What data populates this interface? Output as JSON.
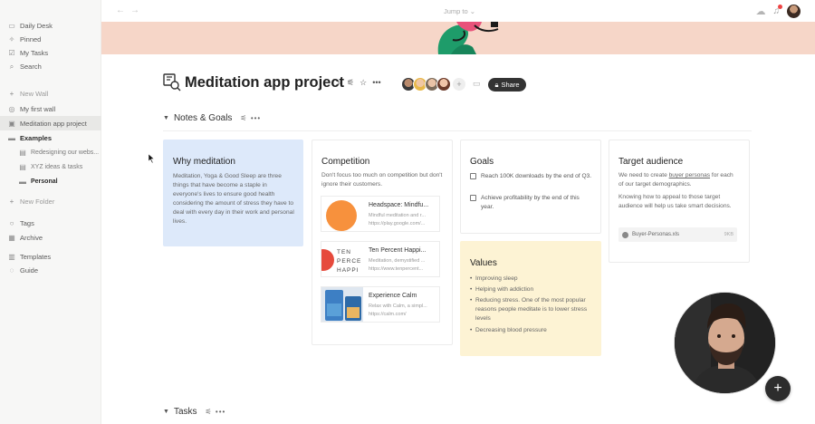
{
  "sidebar": {
    "items": [
      {
        "label": "Daily Desk",
        "icon": "desk-icon"
      },
      {
        "label": "Pinned",
        "icon": "pin-icon"
      },
      {
        "label": "My Tasks",
        "icon": "check-icon"
      },
      {
        "label": "Search",
        "icon": "search-icon"
      }
    ],
    "new_wall": "New Wall",
    "walls": [
      {
        "label": "My first wall"
      },
      {
        "label": "Meditation app project"
      }
    ],
    "folder": {
      "label": "Examples",
      "children": [
        "Redesigning our webs...",
        "XYZ ideas & tasks",
        "Personal"
      ]
    },
    "new_folder": "New Folder",
    "bottom": [
      {
        "label": "Tags"
      },
      {
        "label": "Archive"
      },
      {
        "label": "Templates"
      },
      {
        "label": "Guide"
      }
    ]
  },
  "topbar": {
    "jump_to": "Jump to"
  },
  "header": {
    "title": "Meditation app project",
    "share_label": "Share"
  },
  "sections": {
    "notes": "Notes & Goals",
    "tasks": "Tasks"
  },
  "cards": {
    "why": {
      "title": "Why meditation",
      "body": "Meditation, Yoga & Good Sleep are three things that have become a staple in everyone's lives to ensure good health considering the amount of stress they have to deal with every day in their work and personal lives."
    },
    "competition": {
      "title": "Competition",
      "body": "Don't focus too much on competition but don't ignore their customers.",
      "links": [
        {
          "title": "Headspace: Mindfu...",
          "desc": "Mindful meditation and r...",
          "url": "https://play.google.com/..."
        },
        {
          "title": "Ten Percent Happi...",
          "desc": "Meditation, demystified ...",
          "url": "https://www.tenpercent...",
          "thumb_text": "TEN PERCE HAPPI"
        },
        {
          "title": "Experience Calm",
          "desc": "Relax with Calm, a simpl...",
          "url": "https://calm.com/"
        }
      ]
    },
    "goals": {
      "title": "Goals",
      "items": [
        "Reach 100K downloads by the end of Q3.",
        "Achieve profitability by the end of this year."
      ]
    },
    "values": {
      "title": "Values",
      "items": [
        "Improving sleep",
        "Helping with addiction",
        "Reducing stress. One of the most popular reasons people meditate is to lower stress levels",
        "Decreasing blood pressure"
      ]
    },
    "target": {
      "title": "Target audience",
      "body_pre": "We need to create ",
      "body_link": "buyer personas",
      "body_post": " for each of our target demographics.",
      "body2": "Knowing how to appeal to those target audience will help us take smart decisions.",
      "file_name": "Buyer-Personas.xls",
      "file_size": "9KB"
    }
  },
  "colors": {
    "accent_dark": "#333333",
    "why_bg": "#dde9fa",
    "values_bg": "#fdf3d4",
    "cover_bg": "#f6d6c8",
    "headspace_orange": "#f7913d"
  }
}
